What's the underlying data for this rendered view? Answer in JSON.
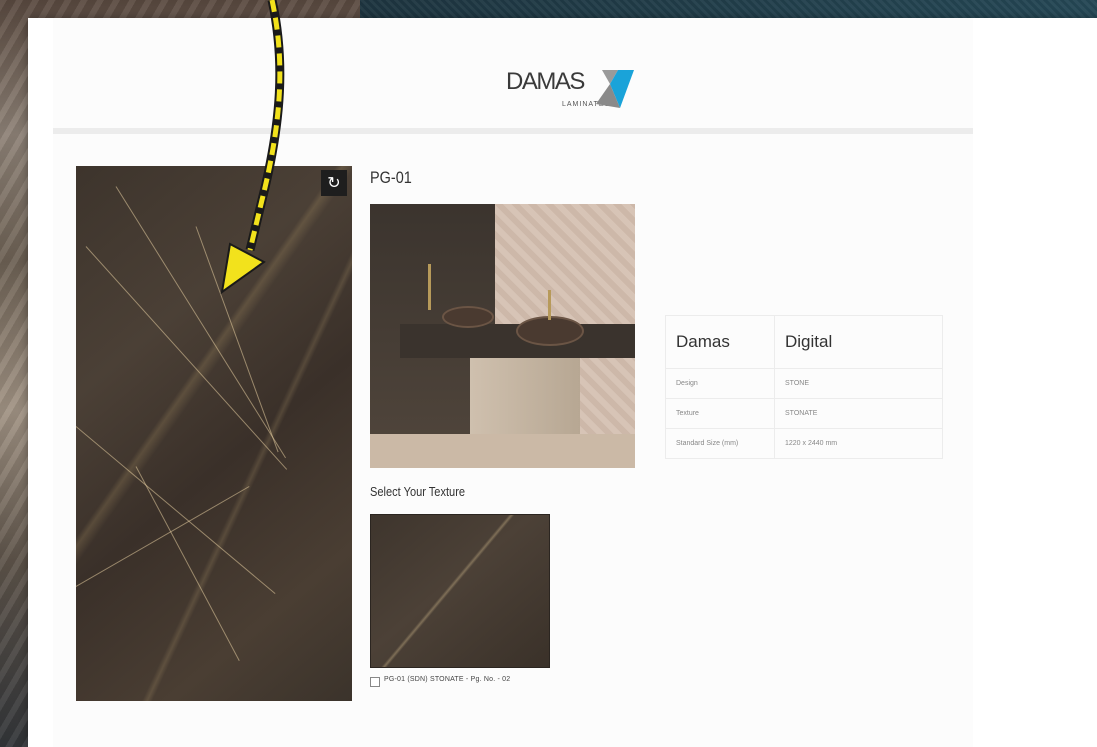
{
  "brand": {
    "logo_word": "DAMAS",
    "logo_sub": "LAMINATES",
    "accent_color": "#1aa3d9",
    "accent_color_2": "#3a3a3a"
  },
  "product": {
    "code": "PG-01",
    "rotate_icon": "rotate-icon"
  },
  "texture_selector": {
    "label": "Select Your Texture",
    "options": [
      {
        "caption": "PG-01 (SDN) STONATE - Pg. No. - 02",
        "checked": false
      }
    ]
  },
  "specs": {
    "header": [
      "Damas",
      "Digital"
    ],
    "rows": [
      {
        "label": "Design",
        "value": "STONE"
      },
      {
        "label": "Texture",
        "value": "STONATE"
      },
      {
        "label": "Standard Size (mm)",
        "value": "1220 x 2440 mm"
      }
    ]
  },
  "annotation": {
    "arrow_color": "#f2e21c",
    "arrow_outline": "#1a1a1a"
  }
}
